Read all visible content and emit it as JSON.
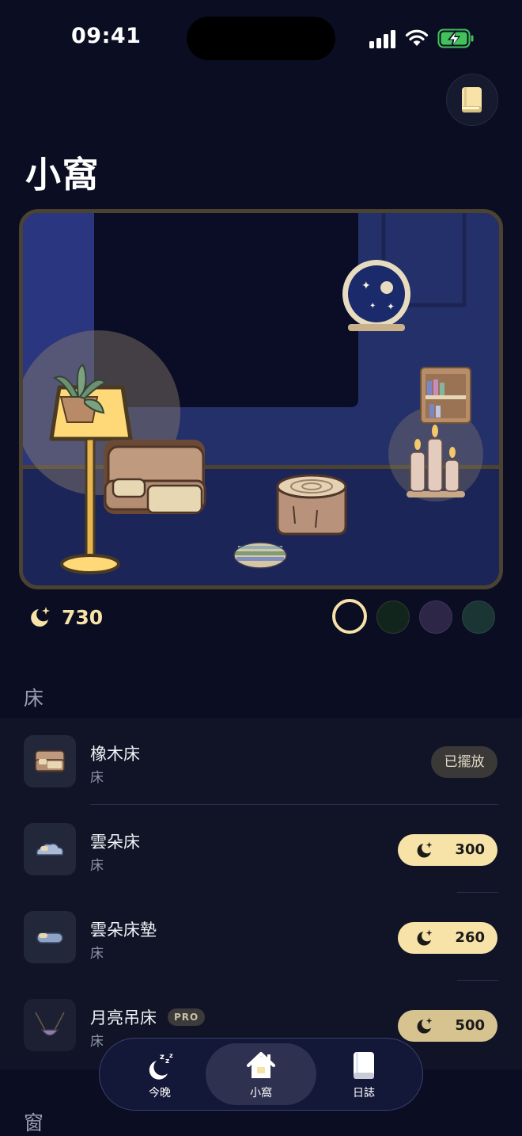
{
  "status_bar": {
    "time": "09:41"
  },
  "page": {
    "title": "小窩"
  },
  "balance": {
    "moons": "730"
  },
  "theme_colors": [
    "#0b0e22",
    "#12251d",
    "#2d2647",
    "#1b3534"
  ],
  "sections": [
    {
      "label": "床"
    },
    {
      "label": "窗"
    }
  ],
  "items": [
    {
      "name": "橡木床",
      "category": "床",
      "action": "已擺放"
    },
    {
      "name": "雲朵床",
      "category": "床",
      "price": "300"
    },
    {
      "name": "雲朵床墊",
      "category": "床",
      "price": "260"
    },
    {
      "name": "月亮吊床",
      "category": "床",
      "price": "500",
      "badge": "PRO"
    }
  ],
  "tabs": [
    {
      "label": "今晚",
      "icon": "moon-sleep-icon"
    },
    {
      "label": "小窩",
      "icon": "house-icon"
    },
    {
      "label": "日誌",
      "icon": "journal-icon"
    }
  ],
  "colors": {
    "accent": "#f7e3a8",
    "background": "#0b0e22",
    "panel": "#111426"
  }
}
